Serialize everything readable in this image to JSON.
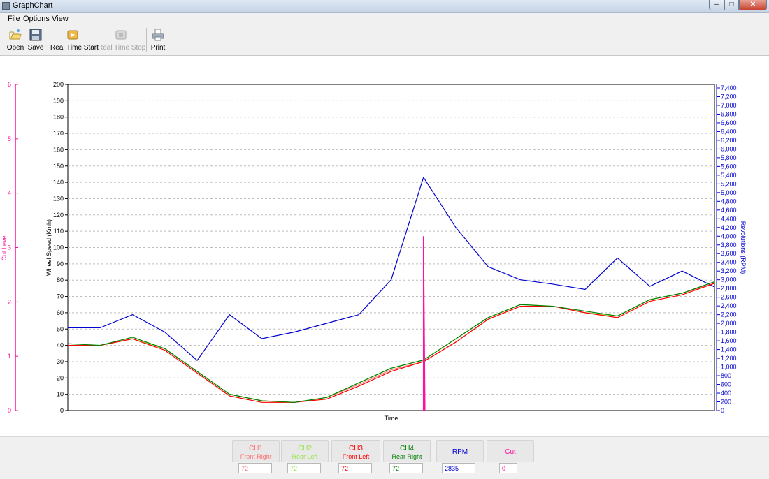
{
  "window": {
    "title": "GraphChart",
    "minimize": "–",
    "maximize": "□",
    "close": "✕"
  },
  "menu": [
    "File",
    "Options",
    "View"
  ],
  "toolbar": {
    "open": "Open",
    "save": "Save",
    "rt_start": "Real Time Start",
    "rt_stop": "Real Time Stop",
    "print": "Print"
  },
  "icons": {
    "open": "folder-open-icon",
    "save": "floppy-disk-icon",
    "rt_start": "play-icon",
    "rt_stop": "stop-icon",
    "print": "printer-icon"
  },
  "colors": {
    "cut": "#ff10a0",
    "ch1": "#ff7070",
    "ch2": "#99e64a",
    "ch3": "#ff0000",
    "ch4": "#008000",
    "rpm": "#0000d0"
  },
  "channels": [
    {
      "name": "CH1",
      "sub": "Front Right",
      "value": "72"
    },
    {
      "name": "CH2",
      "sub": "Rear Left",
      "value": "72"
    },
    {
      "name": "CH3",
      "sub": "Front Left",
      "value": "72"
    },
    {
      "name": "CH4",
      "sub": "Rear Right",
      "value": "72"
    },
    {
      "name": "RPM",
      "sub": "",
      "value": "2835"
    },
    {
      "name": "Cut",
      "sub": "",
      "value": "0"
    }
  ],
  "chart_data": {
    "type": "line",
    "xlabel": "Time",
    "ylabel": "Wheel Speed (Kmh)",
    "y2label": "Revolutions (RPM)",
    "y3label": "Cut Level",
    "ylim": [
      0,
      200
    ],
    "y2lim": [
      0,
      7480
    ],
    "y3lim": [
      0,
      6
    ],
    "yticks": [
      0,
      10,
      20,
      30,
      40,
      50,
      60,
      70,
      80,
      90,
      100,
      110,
      120,
      130,
      140,
      150,
      160,
      170,
      180,
      190,
      200
    ],
    "y2ticks": [
      "0",
      "200",
      "400",
      "600",
      "800",
      "1,000",
      "1,200",
      "1,400",
      "1,600",
      "1,800",
      "2,000",
      "2,200",
      "2,400",
      "2,600",
      "2,800",
      "3,000",
      "3,200",
      "3,400",
      "3,600",
      "3,800",
      "4,000",
      "4,200",
      "4,400",
      "4,600",
      "4,800",
      "5,000",
      "5,200",
      "5,400",
      "5,600",
      "5,800",
      "6,000",
      "6,200",
      "6,400",
      "6,600",
      "6,800",
      "7,000",
      "7,200",
      "7,400"
    ],
    "y3ticks": [
      0,
      1,
      2,
      3,
      4,
      5,
      6
    ],
    "grid": true,
    "x": [
      0,
      5,
      10,
      15,
      20,
      25,
      30,
      35,
      40,
      45,
      50,
      55,
      60,
      65,
      70,
      75,
      80,
      85,
      90,
      95,
      100
    ],
    "series": [
      {
        "name": "CH1",
        "values": [
          40,
          40,
          44,
          38,
          24,
          10,
          6,
          5,
          8,
          16,
          25,
          30,
          42,
          56,
          64,
          64,
          60,
          58,
          68,
          72,
          78
        ]
      },
      {
        "name": "CH2",
        "values": [
          40,
          40,
          44,
          38,
          24,
          10,
          6,
          5,
          8,
          17,
          26,
          31,
          44,
          57,
          65,
          64,
          60,
          58,
          68,
          72,
          79
        ]
      },
      {
        "name": "CH3",
        "values": [
          40,
          40,
          44,
          37,
          23,
          9,
          5,
          5,
          7,
          15,
          24,
          30,
          42,
          56,
          64,
          64,
          60,
          57,
          67,
          71,
          78
        ]
      },
      {
        "name": "CH4",
        "values": [
          41,
          40,
          45,
          38,
          24,
          10,
          6,
          5,
          8,
          17,
          26,
          31,
          44,
          57,
          65,
          64,
          61,
          58,
          68,
          72,
          79
        ]
      },
      {
        "name": "RPM",
        "values": [
          1900,
          1900,
          2200,
          1800,
          1150,
          2200,
          1650,
          1800,
          2000,
          2200,
          3000,
          5350,
          4200,
          3300,
          3000,
          2900,
          2780,
          3500,
          2850,
          3200,
          2835
        ]
      },
      {
        "name": "Cut",
        "values": [
          0,
          0,
          0,
          0,
          0,
          0,
          0,
          0,
          0,
          0,
          0,
          3.2,
          0,
          0,
          0,
          0,
          0,
          0,
          0,
          0,
          0
        ]
      }
    ]
  }
}
